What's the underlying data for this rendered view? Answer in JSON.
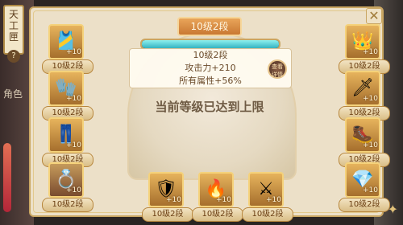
{
  "side": {
    "tab_text": "天工匣",
    "tab_help": "?",
    "role_label": "角色"
  },
  "panel": {
    "close_label": "✕"
  },
  "enhance": {
    "level_title": "10级2段",
    "progress_fraction": 1.0,
    "info_level": "10级2段",
    "attack": "攻击力+210",
    "all_attr": "所有属性+56%",
    "detail_button": "查看详情",
    "max_message": "当前等级已达到上限"
  },
  "equipment": {
    "left": [
      {
        "badge": "10级2段",
        "plus": "+10",
        "icon": "🎽"
      },
      {
        "badge": "10级2段",
        "plus": "+10",
        "icon": "🧤"
      },
      {
        "badge": "10级2段",
        "plus": "+10",
        "icon": "👖"
      },
      {
        "badge": "10级2段",
        "plus": "+10",
        "icon": "💍"
      }
    ],
    "right": [
      {
        "badge": "10级2段",
        "plus": "+10",
        "icon": "👑"
      },
      {
        "badge": "10级2段",
        "plus": "+10",
        "icon": "🗡"
      },
      {
        "badge": "10级2段",
        "plus": "+10",
        "icon": "🥾"
      },
      {
        "badge": "10级2段",
        "plus": "+10",
        "icon": "💎"
      }
    ],
    "bottom": [
      {
        "badge": "10级2段",
        "plus": "+10",
        "icon": "🛡"
      },
      {
        "badge": "10级2段",
        "plus": "+10",
        "icon": "🔥"
      },
      {
        "badge": "10级2段",
        "plus": "+10",
        "icon": "⚔"
      }
    ]
  },
  "colors": {
    "accent": "#c97832",
    "progress": "#34b3c1",
    "text_dark": "#6a4a2a"
  }
}
